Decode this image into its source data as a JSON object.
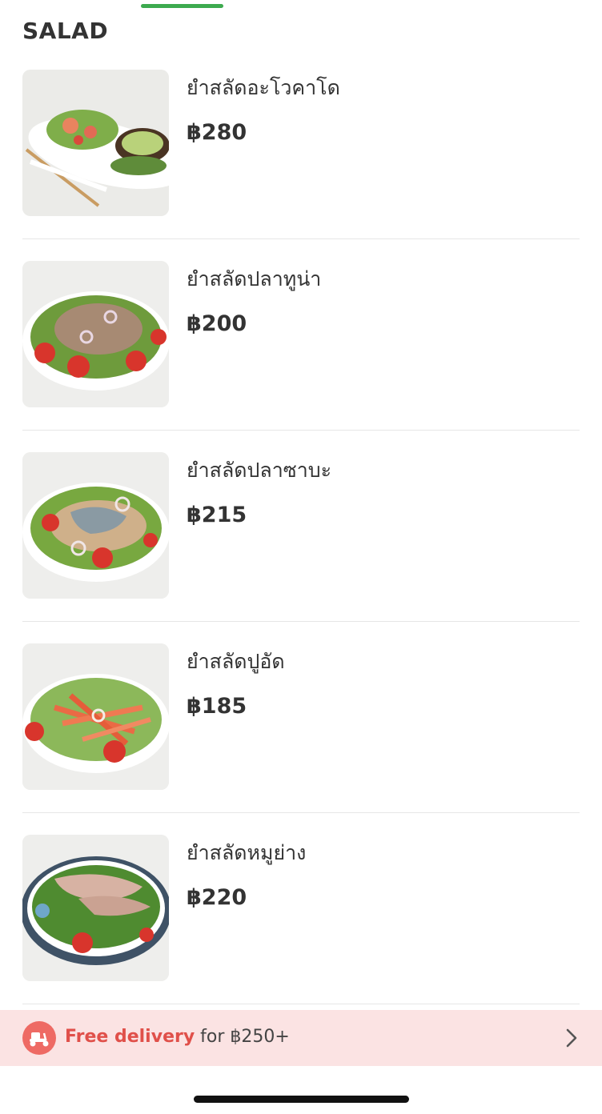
{
  "section": {
    "title": "SALAD"
  },
  "menu": {
    "items": [
      {
        "name": "ยำสลัดอะโวคาโด",
        "price": "฿280"
      },
      {
        "name": "ยำสลัดปลาทูน่า",
        "price": "฿200"
      },
      {
        "name": "ยำสลัดปลาซาบะ",
        "price": "฿215"
      },
      {
        "name": "ยำสลัดปูอัด",
        "price": "฿185"
      },
      {
        "name": "ยำสลัดหมูย่าง",
        "price": "฿220"
      }
    ]
  },
  "promo": {
    "highlight": "Free delivery",
    "text": " for ฿250+",
    "icon": "scooter-icon"
  },
  "colors": {
    "accent_green": "#3daa4f",
    "promo_bg": "#fbe3e3",
    "promo_red": "#e0504a"
  }
}
